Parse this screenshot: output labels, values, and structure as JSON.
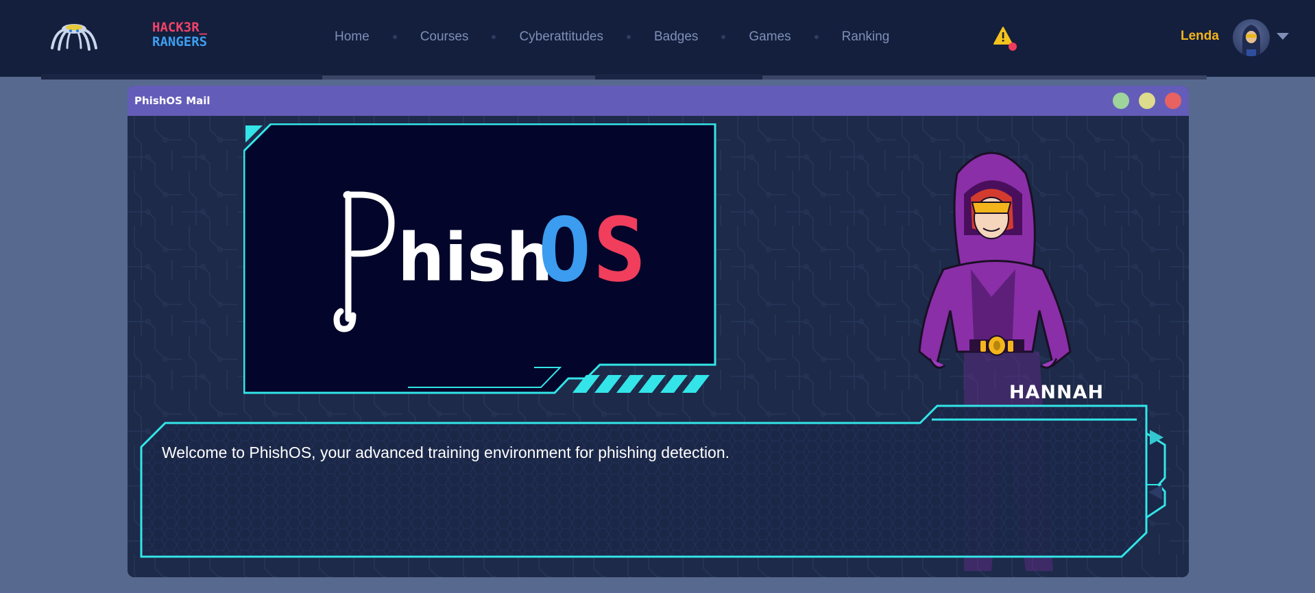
{
  "nav": {
    "brand_line1": "HACK3R_",
    "brand_line2": "RANGERS",
    "items": [
      {
        "label": "Home"
      },
      {
        "label": "Courses"
      },
      {
        "label": "Cyberattitudes"
      },
      {
        "label": "Badges"
      },
      {
        "label": "Games"
      },
      {
        "label": "Ranking"
      }
    ],
    "username": "Lenda",
    "icons": {
      "logo": "spider-logo-icon",
      "alert": "warning-triangle-icon",
      "menu": "chevron-down-icon"
    }
  },
  "window": {
    "title": "PhishOS Mail",
    "controls": [
      "minimize",
      "maximize",
      "close"
    ],
    "control_colors": {
      "minimize": "#9ed39c",
      "maximize": "#dcdc8c",
      "close": "#e86262"
    }
  },
  "logo": {
    "part_white": "hish",
    "part_blue": "O",
    "part_red": "S",
    "colors": {
      "white": "#ffffff",
      "blue": "#3b9cf0",
      "red": "#f03e5c"
    }
  },
  "dialog": {
    "speaker": "HANNAH",
    "message": "Welcome to PhishOS, your advanced training environment for phishing detection."
  },
  "colors": {
    "accent": "#33e5e8",
    "alert_dot": "#ef3b5c",
    "user": "#f4b51c"
  }
}
